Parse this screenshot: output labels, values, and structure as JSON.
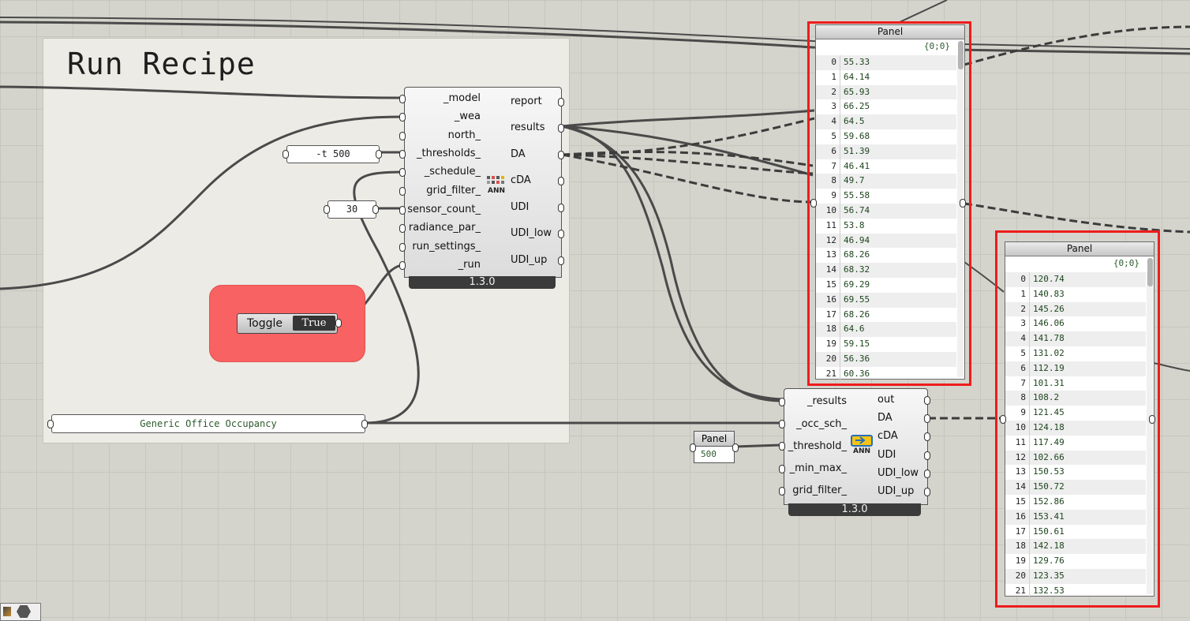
{
  "group": {
    "title": "Run Recipe"
  },
  "recipe_params": {
    "thresholds": "-t 500",
    "sensor_count": "30",
    "schedule": "Generic Office Occupancy"
  },
  "toggle": {
    "label": "Toggle",
    "value": "True"
  },
  "daylight_component": {
    "inputs": [
      "_model",
      "_wea",
      "north_",
      "_thresholds_",
      "_schedule_",
      "grid_filter_",
      "sensor_count_",
      "radiance_par_",
      "run_settings_",
      "_run"
    ],
    "outputs": [
      "report",
      "results",
      "DA",
      "cDA",
      "UDI",
      "UDI_low",
      "UDI_up"
    ],
    "version": "1.3.0",
    "icon_label": "ANN"
  },
  "postprocess_component": {
    "inputs": [
      "_results",
      "_occ_sch_",
      "_threshold_",
      "_min_max_",
      "grid_filter_"
    ],
    "outputs": [
      "out",
      "DA",
      "cDA",
      "UDI",
      "UDI_low",
      "UDI_up"
    ],
    "version": "1.3.0",
    "icon_label": "ANN"
  },
  "threshold_panel": {
    "title": "Panel",
    "value": "500"
  },
  "panel1": {
    "title": "Panel",
    "path": "{0;0}",
    "rows": [
      {
        "i": "0",
        "v": "55.33"
      },
      {
        "i": "1",
        "v": "64.14"
      },
      {
        "i": "2",
        "v": "65.93"
      },
      {
        "i": "3",
        "v": "66.25"
      },
      {
        "i": "4",
        "v": "64.5"
      },
      {
        "i": "5",
        "v": "59.68"
      },
      {
        "i": "6",
        "v": "51.39"
      },
      {
        "i": "7",
        "v": "46.41"
      },
      {
        "i": "8",
        "v": "49.7"
      },
      {
        "i": "9",
        "v": "55.58"
      },
      {
        "i": "10",
        "v": "56.74"
      },
      {
        "i": "11",
        "v": "53.8"
      },
      {
        "i": "12",
        "v": "46.94"
      },
      {
        "i": "13",
        "v": "68.26"
      },
      {
        "i": "14",
        "v": "68.32"
      },
      {
        "i": "15",
        "v": "69.29"
      },
      {
        "i": "16",
        "v": "69.55"
      },
      {
        "i": "17",
        "v": "68.26"
      },
      {
        "i": "18",
        "v": "64.6"
      },
      {
        "i": "19",
        "v": "59.15"
      },
      {
        "i": "20",
        "v": "56.36"
      },
      {
        "i": "21",
        "v": "60.36"
      }
    ]
  },
  "panel2": {
    "title": "Panel",
    "path": "{0;0}",
    "rows": [
      {
        "i": "0",
        "v": "120.74"
      },
      {
        "i": "1",
        "v": "140.83"
      },
      {
        "i": "2",
        "v": "145.26"
      },
      {
        "i": "3",
        "v": "146.06"
      },
      {
        "i": "4",
        "v": "141.78"
      },
      {
        "i": "5",
        "v": "131.02"
      },
      {
        "i": "6",
        "v": "112.19"
      },
      {
        "i": "7",
        "v": "101.31"
      },
      {
        "i": "8",
        "v": "108.2"
      },
      {
        "i": "9",
        "v": "121.45"
      },
      {
        "i": "10",
        "v": "124.18"
      },
      {
        "i": "11",
        "v": "117.49"
      },
      {
        "i": "12",
        "v": "102.66"
      },
      {
        "i": "13",
        "v": "150.53"
      },
      {
        "i": "14",
        "v": "150.72"
      },
      {
        "i": "15",
        "v": "152.86"
      },
      {
        "i": "16",
        "v": "153.41"
      },
      {
        "i": "17",
        "v": "150.61"
      },
      {
        "i": "18",
        "v": "142.18"
      },
      {
        "i": "19",
        "v": "129.76"
      },
      {
        "i": "20",
        "v": "123.35"
      },
      {
        "i": "21",
        "v": "132.53"
      }
    ]
  },
  "colors": {
    "canvas": "#d4d4cc",
    "group": "#ecebe5",
    "toggle_group": "#f96262",
    "highlight": "#ee1c1c",
    "wire": "#4a4a4a"
  },
  "icons": {
    "corner_tools": [
      "hammer-icon",
      "hexagon-icon"
    ]
  }
}
